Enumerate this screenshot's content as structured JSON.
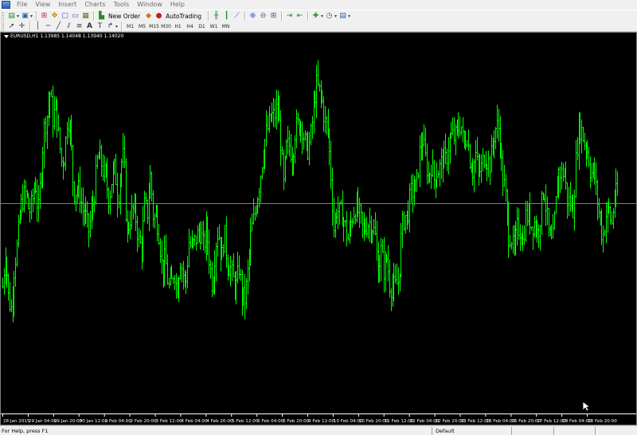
{
  "menu": {
    "items": [
      "File",
      "View",
      "Insert",
      "Charts",
      "Tools",
      "Window",
      "Help"
    ]
  },
  "toolbar": {
    "new_order_label": "New Order",
    "autotrading_label": "AutoTrading",
    "timeframes": [
      "M1",
      "M5",
      "M15",
      "M30",
      "H1",
      "H4",
      "D1",
      "W1",
      "MN"
    ]
  },
  "chart": {
    "header": "EURUSD,H1  1.13985 1.14048 1.13940 1.14020",
    "background": "#000000",
    "bar_color": "#00ff00",
    "bid_line_color": "#808080"
  },
  "chart_data": {
    "type": "ohlc",
    "symbol": "EURUSD",
    "timeframe": "H1",
    "last_bar": {
      "open": 1.13985,
      "high": 1.14048,
      "low": 1.1394,
      "close": 1.1402
    },
    "x_tick_labels": [
      "28 Jan 2015",
      "29 Jan 04:00",
      "29 Jan 20:00",
      "30 Jan 12:00",
      "2 Feb 04:00",
      "2 Feb 20:00",
      "3 Feb 12:00",
      "4 Feb 04:00",
      "4 Feb 20:00",
      "5 Feb 12:00",
      "6 Feb 04:00",
      "6 Feb 20:00",
      "9 Feb 12:00",
      "10 Feb 04:00",
      "10 Feb 20:00",
      "11 Feb 12:00",
      "12 Feb 04:00",
      "12 Feb 20:00",
      "13 Feb 12:00",
      "16 Feb 04:00",
      "16 Feb 20:00",
      "17 Feb 12:00",
      "18 Feb 04:00",
      "18 Feb 20:00"
    ],
    "close_trace": [
      0.34,
      0.45,
      0.3,
      0.27,
      0.41,
      0.47,
      0.58,
      0.62,
      0.63,
      0.57,
      0.6,
      0.67,
      0.56,
      0.7,
      0.83,
      0.87,
      0.94,
      0.86,
      0.9,
      0.8,
      0.72,
      0.75,
      0.88,
      0.81,
      0.63,
      0.64,
      0.64,
      0.58,
      0.56,
      0.51,
      0.56,
      0.63,
      0.73,
      0.74,
      0.7,
      0.67,
      0.61,
      0.68,
      0.71,
      0.6,
      0.72,
      0.75,
      0.5,
      0.55,
      0.58,
      0.56,
      0.48,
      0.46,
      0.59,
      0.57,
      0.69,
      0.55,
      0.56,
      0.5,
      0.39,
      0.43,
      0.34,
      0.34,
      0.4,
      0.32,
      0.43,
      0.38,
      0.35,
      0.48,
      0.46,
      0.48,
      0.5,
      0.51,
      0.46,
      0.52,
      0.41,
      0.34,
      0.47,
      0.52,
      0.42,
      0.51,
      0.41,
      0.4,
      0.36,
      0.34,
      0.4,
      0.31,
      0.3,
      0.39,
      0.51,
      0.55,
      0.61,
      0.67,
      0.75,
      0.81,
      0.84,
      0.87,
      0.87,
      0.9,
      0.8,
      0.65,
      0.77,
      0.78,
      0.74,
      0.83,
      0.84,
      0.85,
      0.8,
      0.76,
      0.79,
      0.87,
      0.97,
      0.95,
      0.92,
      0.85,
      0.83,
      0.69,
      0.52,
      0.58,
      0.57,
      0.56,
      0.52,
      0.48,
      0.55,
      0.58,
      0.58,
      0.55,
      0.51,
      0.53,
      0.54,
      0.53,
      0.5,
      0.39,
      0.45,
      0.39,
      0.43,
      0.34,
      0.34,
      0.34,
      0.36,
      0.52,
      0.56,
      0.56,
      0.63,
      0.64,
      0.65,
      0.75,
      0.8,
      0.74,
      0.68,
      0.72,
      0.67,
      0.7,
      0.71,
      0.74,
      0.73,
      0.79,
      0.81,
      0.8,
      0.83,
      0.85,
      0.77,
      0.82,
      0.74,
      0.7,
      0.75,
      0.69,
      0.71,
      0.75,
      0.73,
      0.72,
      0.8,
      0.84,
      0.83,
      0.68,
      0.64,
      0.5,
      0.5,
      0.44,
      0.52,
      0.52,
      0.48,
      0.56,
      0.56,
      0.53,
      0.54,
      0.5,
      0.57,
      0.66,
      0.57,
      0.48,
      0.47,
      0.58,
      0.7,
      0.69,
      0.7,
      0.61,
      0.6,
      0.58,
      0.74,
      0.84,
      0.82,
      0.78,
      0.76,
      0.69,
      0.7,
      0.62,
      0.55,
      0.49,
      0.56,
      0.58,
      0.53,
      0.62,
      0.63
    ],
    "bid_line_level": 0.6,
    "grid": false
  },
  "status": {
    "help_text": "For Help, press F1",
    "profile": "Default"
  },
  "icons": {
    "toolbar1": [
      "new-chart-icon",
      "profiles-icon",
      "market-watch-icon",
      "data-window-icon",
      "navigator-icon",
      "terminal-icon",
      "strategy-tester-icon",
      "new-order-icon",
      "metaeditor-icon",
      "autotrading-icon",
      "bar-chart-icon",
      "candlesticks-icon",
      "line-chart-icon",
      "zoom-in-icon",
      "zoom-out-icon",
      "tile-windows-icon",
      "chart-shift-icon",
      "autoscroll-icon",
      "indicators-icon",
      "periods-icon",
      "templates-icon"
    ],
    "toolbar2": [
      "cursor-icon",
      "crosshair-icon",
      "vertical-line-icon",
      "horizontal-line-icon",
      "trendline-icon",
      "equidistant-channel-icon",
      "fibonacci-icon",
      "text-icon",
      "text-label-icon",
      "arrows-icon"
    ]
  }
}
